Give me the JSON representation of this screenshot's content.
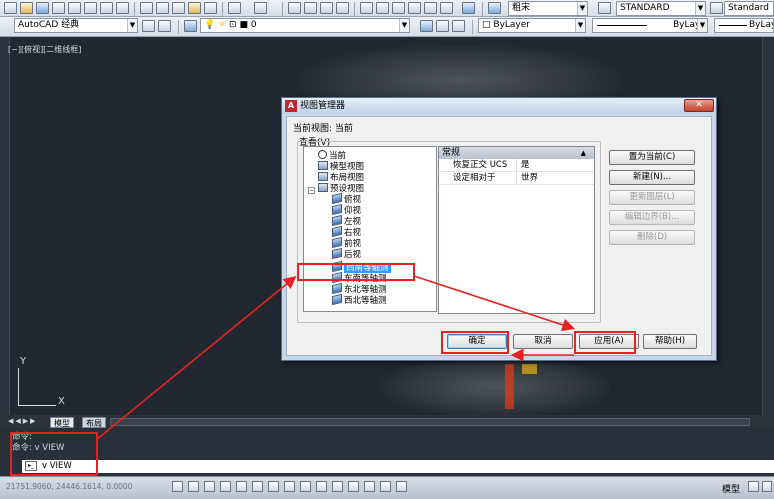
{
  "toolbar": {
    "workspace": "AutoCAD 经典",
    "layer_value": "0",
    "font_value": "粗宋",
    "textstyle": "STANDARD",
    "tablestyle": "Standard",
    "color": "ByLayer",
    "linetype": "ByLayer",
    "lineweight": "ByLayer"
  },
  "viewport_label": "[−][俯视][二维线框]",
  "dialog": {
    "title": "视图管理器",
    "current_view_label": "当前视图:",
    "current_view_value": "当前",
    "view_group_label": "查看(V)",
    "tree": [
      {
        "label": "当前",
        "icon": "magnifier-icon",
        "level": 1
      },
      {
        "label": "模型视图",
        "icon": "model-views-icon",
        "level": 1
      },
      {
        "label": "布局视图",
        "icon": "layout-views-icon",
        "level": 1
      },
      {
        "label": "预设视图",
        "icon": "preset-views-icon",
        "level": 1
      },
      {
        "label": "俯视",
        "icon": "top-view-icon",
        "level": 2
      },
      {
        "label": "仰视",
        "icon": "bottom-view-icon",
        "level": 2
      },
      {
        "label": "左视",
        "icon": "left-view-icon",
        "level": 2
      },
      {
        "label": "右视",
        "icon": "right-view-icon",
        "level": 2
      },
      {
        "label": "前视",
        "icon": "front-view-icon",
        "level": 2
      },
      {
        "label": "后视",
        "icon": "back-view-icon",
        "level": 2
      },
      {
        "label": "西南等轴测",
        "icon": "sw-iso-icon",
        "level": 2,
        "selected": true
      },
      {
        "label": "东南等轴测",
        "icon": "se-iso-icon",
        "level": 2
      },
      {
        "label": "东北等轴测",
        "icon": "ne-iso-icon",
        "level": 2
      },
      {
        "label": "西北等轴测",
        "icon": "nw-iso-icon",
        "level": 2
      }
    ],
    "props_header": "常规",
    "props": [
      {
        "key": "恢复正交 UCS",
        "value": "是"
      },
      {
        "key": "设定相对于",
        "value": "世界"
      }
    ],
    "buttons": {
      "set_current": "置为当前(C)",
      "new": "新建(N)...",
      "update_layers": "更新图层(L)",
      "edit_boundaries": "编辑边界(B)...",
      "delete": "删除(D)",
      "ok": "确定",
      "cancel": "取消",
      "apply": "应用(A)",
      "help": "帮助(H)"
    }
  },
  "tabs": {
    "model": "模型",
    "layout": "布局"
  },
  "command": {
    "history_1": "命令:",
    "history_2": "命令: v VIEW",
    "input": "v VIEW"
  },
  "status": {
    "coords": "21751.9060, 24446.1614, 0.0000",
    "model_label": "模型"
  },
  "ucs": {
    "x": "X",
    "y": "Y"
  }
}
